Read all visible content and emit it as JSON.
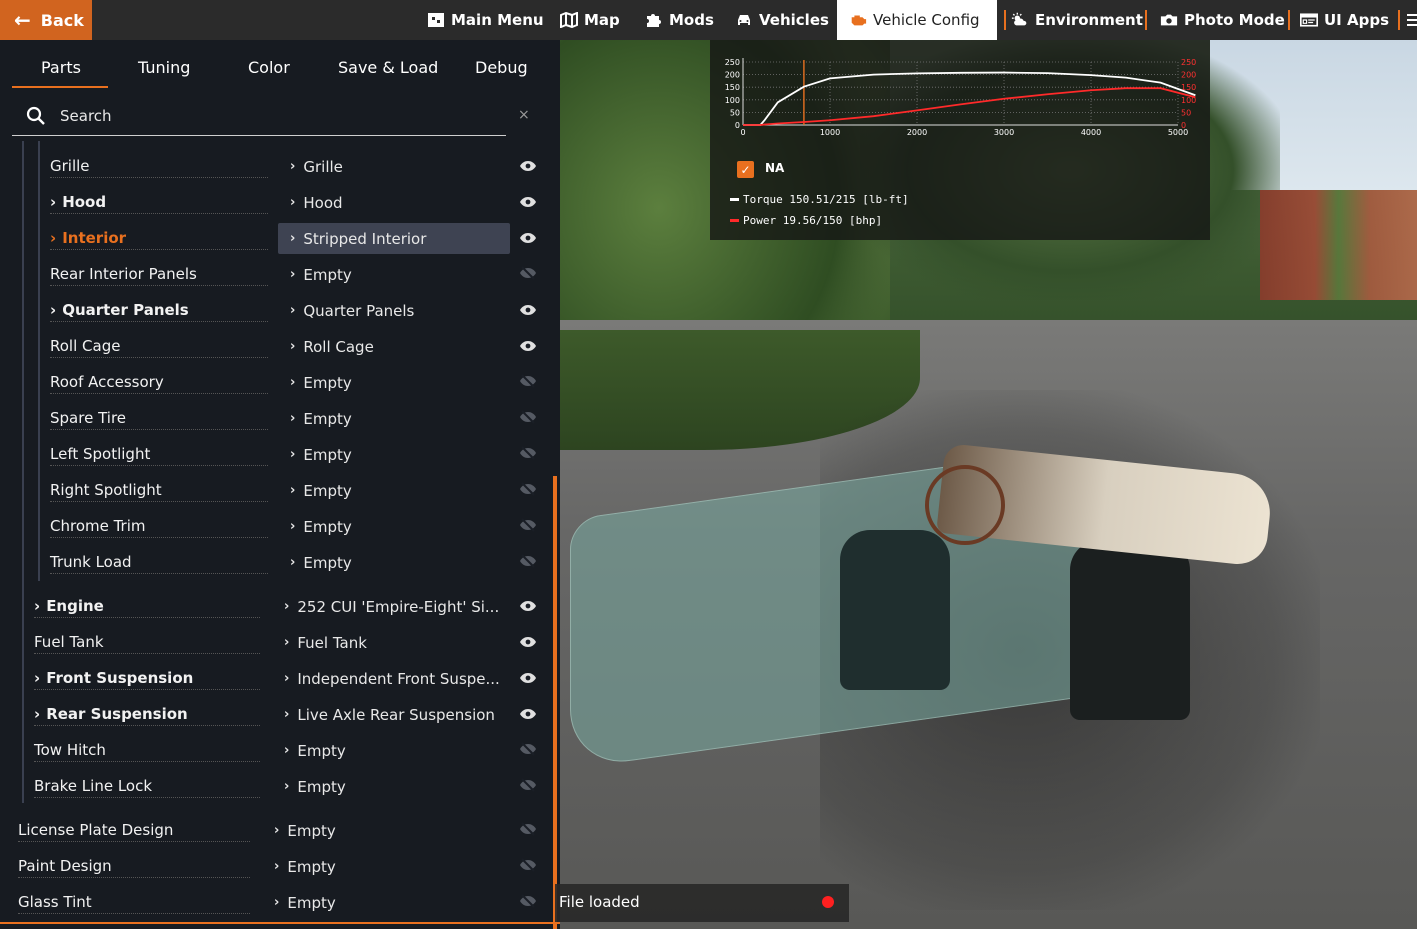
{
  "topbar": {
    "back_label": "Back",
    "nav": [
      {
        "label": "Main Menu",
        "icon": "main-menu-icon"
      },
      {
        "label": "Map",
        "icon": "map-icon"
      },
      {
        "label": "Mods",
        "icon": "puzzle-icon"
      },
      {
        "label": "Vehicles",
        "icon": "car-icon"
      },
      {
        "label": "Vehicle Config",
        "icon": "engine-icon",
        "active": true
      },
      {
        "label": "Environment",
        "icon": "weather-icon"
      },
      {
        "label": "Photo Mode",
        "icon": "camera-icon"
      },
      {
        "label": "UI Apps",
        "icon": "ui-apps-icon"
      }
    ],
    "accent_color": "#e8701f"
  },
  "panel": {
    "tabs": [
      "Parts",
      "Tuning",
      "Color",
      "Save & Load",
      "Debug"
    ],
    "active_tab": "Parts",
    "search": {
      "placeholder": "Search",
      "value": "",
      "clear": "×"
    }
  },
  "parts": [
    {
      "label": "Grille",
      "value": "Grille",
      "expandable": false,
      "visible": true
    },
    {
      "label": "Hood",
      "value": "Hood",
      "expandable": true,
      "visible": true
    },
    {
      "label": "Interior",
      "value": "Stripped Interior",
      "expandable": true,
      "visible": true,
      "selected": true
    },
    {
      "label": "Rear Interior Panels",
      "value": "Empty",
      "expandable": false,
      "visible": false
    },
    {
      "label": "Quarter Panels",
      "value": "Quarter Panels",
      "expandable": true,
      "visible": true
    },
    {
      "label": "Roll Cage",
      "value": "Roll Cage",
      "expandable": false,
      "visible": true
    },
    {
      "label": "Roof Accessory",
      "value": "Empty",
      "expandable": false,
      "visible": false
    },
    {
      "label": "Spare Tire",
      "value": "Empty",
      "expandable": false,
      "visible": false
    },
    {
      "label": "Left Spotlight",
      "value": "Empty",
      "expandable": false,
      "visible": false
    },
    {
      "label": "Right Spotlight",
      "value": "Empty",
      "expandable": false,
      "visible": false
    },
    {
      "label": "Chrome Trim",
      "value": "Empty",
      "expandable": false,
      "visible": false
    },
    {
      "label": "Trunk Load",
      "value": "Empty",
      "expandable": false,
      "visible": false
    },
    {
      "label": "Engine",
      "value": "252 CUI 'Empire-Eight' Si...",
      "expandable": true,
      "visible": true
    },
    {
      "label": "Fuel Tank",
      "value": "Fuel Tank",
      "expandable": false,
      "visible": true
    },
    {
      "label": "Front Suspension",
      "value": "Independent Front Suspe...",
      "expandable": true,
      "visible": true
    },
    {
      "label": "Rear Suspension",
      "value": "Live Axle Rear Suspension",
      "expandable": true,
      "visible": true
    },
    {
      "label": "Tow Hitch",
      "value": "Empty",
      "expandable": false,
      "visible": false
    },
    {
      "label": "Brake Line Lock",
      "value": "Empty",
      "expandable": false,
      "visible": false
    },
    {
      "label": "License Plate Design",
      "value": "Empty",
      "expandable": false,
      "visible": false
    },
    {
      "label": "Paint Design",
      "value": "Empty",
      "expandable": false,
      "visible": false
    },
    {
      "label": "Glass Tint",
      "value": "Empty",
      "expandable": false,
      "visible": false
    }
  ],
  "graph": {
    "na_label": "NA",
    "na_checked": true,
    "torque_legend": "Torque 150.51/215 [lb-ft]",
    "power_legend": "Power 19.56/150  [bhp]",
    "torque_color": "#ffffff",
    "power_color": "#ff2a2a",
    "left_ticks": [
      "250",
      "200",
      "150",
      "100",
      "50",
      "0"
    ],
    "right_ticks": [
      "250",
      "200",
      "150",
      "100",
      "50",
      "0"
    ],
    "x_ticks": [
      "0",
      "1000",
      "2000",
      "3000",
      "4000",
      "5000"
    ]
  },
  "chart_data": {
    "type": "line",
    "xlim": [
      0,
      5000
    ],
    "ylim": [
      0,
      250
    ],
    "x": [
      0,
      200,
      250,
      400,
      700,
      1000,
      1500,
      2000,
      2500,
      3000,
      3500,
      4000,
      4400,
      4800,
      5200
    ],
    "series": [
      {
        "name": "Torque",
        "values": [
          0,
          0,
          20,
          90,
          152,
          185,
          200,
          205,
          207,
          208,
          206,
          198,
          188,
          168,
          118
        ]
      },
      {
        "name": "Power",
        "values": [
          0,
          0,
          2,
          6,
          12,
          19,
          35,
          58,
          82,
          104,
          122,
          138,
          146,
          146,
          110
        ]
      }
    ],
    "marker_x": 700
  },
  "status": {
    "text": "File loaded",
    "dot_color": "#ff2020"
  }
}
